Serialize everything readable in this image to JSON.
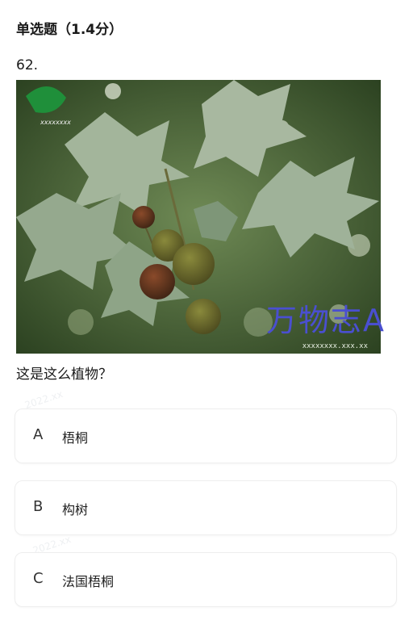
{
  "question": {
    "type_label": "单选题（1.4分）",
    "number": "62.",
    "text": "这是这么植物？"
  },
  "image": {
    "watermark": "万物志A",
    "credit": "xxxxxxxx.xxx.xx",
    "stamp_text": "xxxxxxxx"
  },
  "options": [
    {
      "letter": "A",
      "label": "梧桐"
    },
    {
      "letter": "B",
      "label": "构树"
    },
    {
      "letter": "C",
      "label": "法国梧桐"
    }
  ]
}
